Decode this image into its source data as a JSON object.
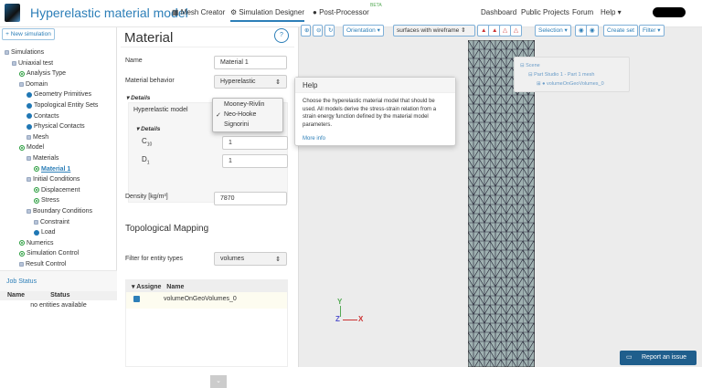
{
  "header": {
    "title": "Hyperelastic material model",
    "nav": [
      "Mesh Creator",
      "Simulation Designer",
      "Post-Processor"
    ],
    "beta": "BETA",
    "links": [
      "Dashboard",
      "Public Projects",
      "Forum",
      "Help ▾"
    ]
  },
  "sidebar": {
    "new_simulation": "+ New simulation",
    "tree": [
      {
        "label": "Simulations",
        "icon": "collapse",
        "level": 0
      },
      {
        "label": "Uniaxial test",
        "icon": "collapse",
        "level": 1
      },
      {
        "label": "Analysis Type",
        "icon": "check",
        "level": 2
      },
      {
        "label": "Domain",
        "icon": "collapse",
        "level": 2
      },
      {
        "label": "Geometry Primitives",
        "icon": "dot",
        "level": 3
      },
      {
        "label": "Topological Entity Sets",
        "icon": "dot",
        "level": 3
      },
      {
        "label": "Contacts",
        "icon": "dot",
        "level": 3
      },
      {
        "label": "Physical Contacts",
        "icon": "dot",
        "level": 3
      },
      {
        "label": "Mesh",
        "icon": "expand",
        "level": 3
      },
      {
        "label": "Model",
        "icon": "check",
        "level": 2
      },
      {
        "label": "Materials",
        "icon": "collapse",
        "level": 3
      },
      {
        "label": "Material 1",
        "icon": "check",
        "level": 4
      },
      {
        "label": "Initial Conditions",
        "icon": "collapse",
        "level": 3
      },
      {
        "label": "Displacement",
        "icon": "check",
        "level": 4
      },
      {
        "label": "Stress",
        "icon": "check",
        "level": 4
      },
      {
        "label": "Boundary Conditions",
        "icon": "collapse",
        "level": 3
      },
      {
        "label": "Constraint",
        "icon": "expand",
        "level": 4
      },
      {
        "label": "Load",
        "icon": "dot",
        "level": 4
      },
      {
        "label": "Numerics",
        "icon": "check",
        "level": 2
      },
      {
        "label": "Simulation Control",
        "icon": "check",
        "level": 2
      },
      {
        "label": "Result Control",
        "icon": "expand",
        "level": 2
      }
    ],
    "job_status": {
      "title": "Job Status",
      "columns": [
        "Name",
        "Status"
      ],
      "empty": "no entities available"
    }
  },
  "material": {
    "title": "Material",
    "help": "?",
    "name_label": "Name",
    "name_value": "Material 1",
    "behavior_label": "Material behavior",
    "behavior_value": "Hyperelastic",
    "details": "Details",
    "hyper_label": "Hyperelastic model",
    "details2": "Details",
    "c10_label": "C",
    "c10_sub": "10",
    "c10_value": "1",
    "d1_label": "D",
    "d1_sub": "1",
    "d1_value": "1",
    "density_label": "Density [kg/m³]",
    "density_value": "7870",
    "topo_title": "Topological Mapping",
    "filter_label": "Filter for entity types",
    "filter_value": "volumes",
    "table_cols": [
      "Assigne",
      "Name"
    ],
    "table_rows": [
      {
        "checked": true,
        "name": "volumeOnGeoVolumes_0"
      }
    ]
  },
  "dropdown": {
    "options": [
      "Mooney-Rivlin",
      "Neo-Hooke",
      "Signorini"
    ],
    "selected": "Neo-Hooke"
  },
  "help_popup": {
    "title": "Help",
    "text": "Choose the hyperelastic material model that should be used. All models derive the stress-strain relation from a strain energy function defined by the material model parameters.",
    "link": "More info"
  },
  "viewer": {
    "toolbar": {
      "orientation": "Orientation ▾",
      "render_mode": "surfaces with wireframe",
      "selection": "Selection ▾",
      "create_set": "Create set",
      "filter": "Filter ▾"
    },
    "scene": [
      "Scene",
      "Part Studio 1 - Part 1 mesh",
      "volumeOnGeoVolumes_0"
    ],
    "axes": [
      "Y",
      "Z",
      "X"
    ],
    "report": "Report an issue"
  },
  "colors": {
    "accent": "#2d7fb8",
    "check": "#2a9d3e",
    "mesh": "#9fb1b1"
  }
}
